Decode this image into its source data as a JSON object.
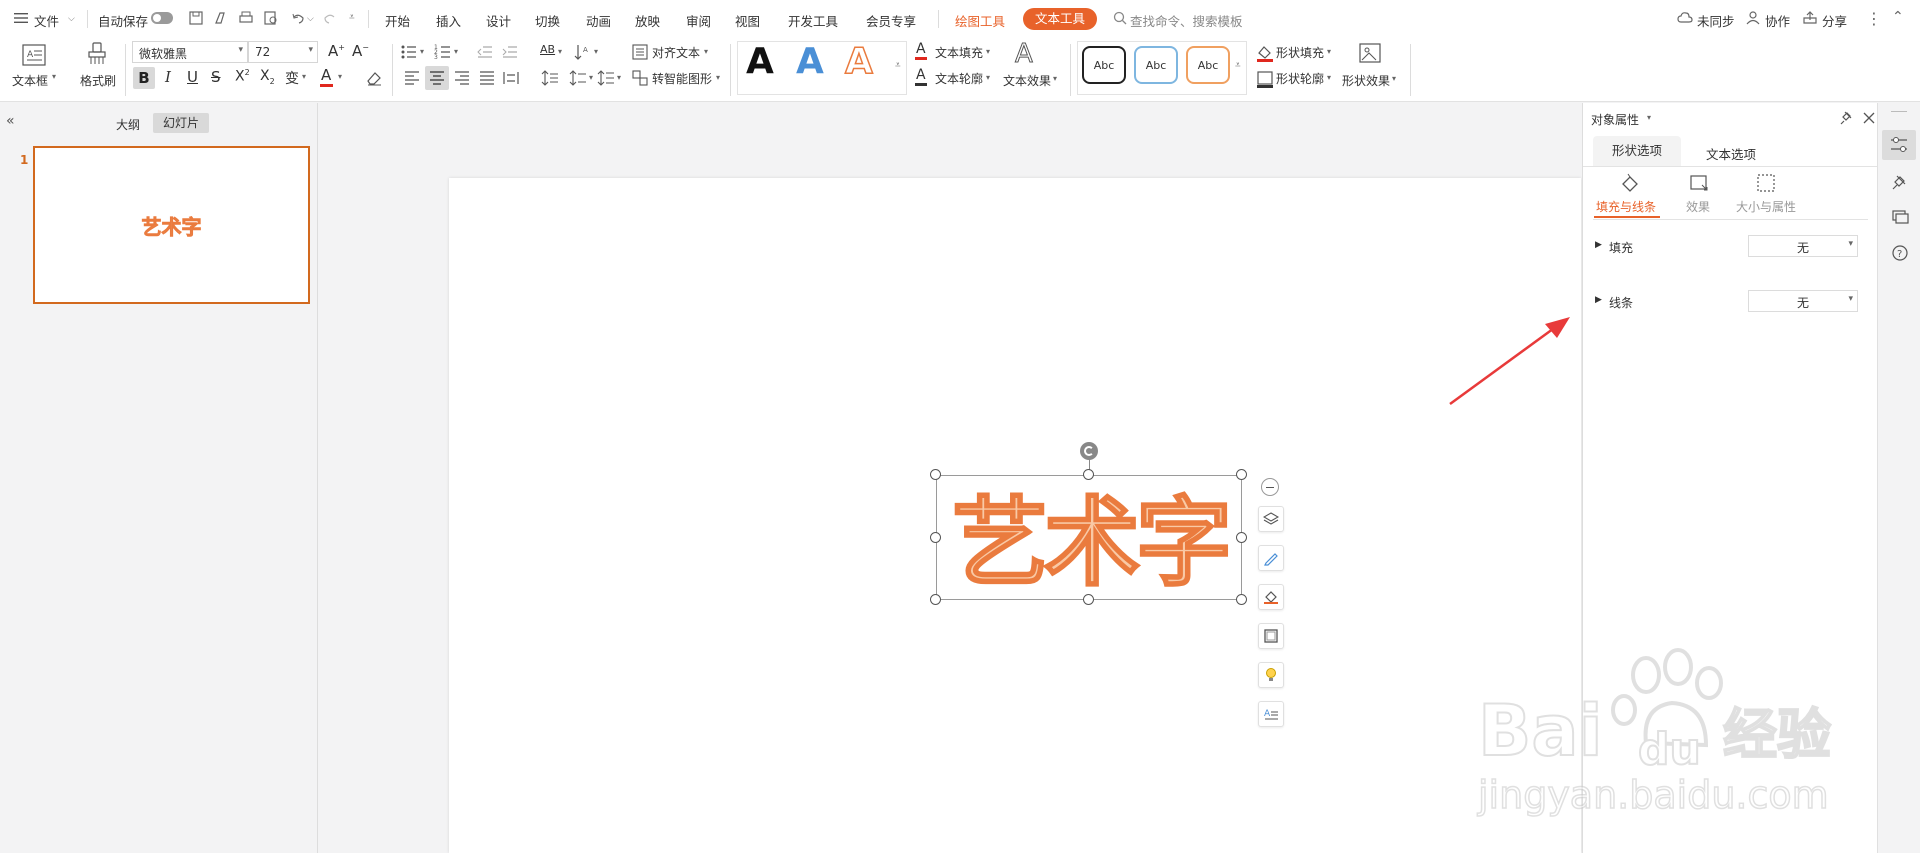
{
  "menubar": {
    "file": "文件",
    "autosave": "自动保存",
    "tabs": [
      "开始",
      "插入",
      "设计",
      "切换",
      "动画",
      "放映",
      "审阅",
      "视图",
      "开发工具",
      "会员专享"
    ],
    "drawing_tools": "绘图工具",
    "text_tools": "文本工具",
    "search_placeholder": "查找命令、搜索模板",
    "unsynced": "未同步",
    "collaborate": "协作",
    "share": "分享"
  },
  "ribbon": {
    "textbox": "文本框",
    "format_painter": "格式刷",
    "font_name": "微软雅黑",
    "font_size": "72",
    "align_text": "对齐文本",
    "smart_shape": "转智能图形",
    "wordart_letter": "A",
    "text_fill": "文本填充",
    "text_outline": "文本轮廓",
    "text_effect": "文本效果",
    "abc": "Abc",
    "shape_fill": "形状填充",
    "shape_outline": "形状轮廓",
    "shape_effect": "形状效果"
  },
  "leftpanel": {
    "tab_outline": "大纲",
    "tab_slides": "幻灯片",
    "slide_number": "1",
    "thumb_text": "艺术字"
  },
  "slide": {
    "wordart_text": "艺术字"
  },
  "proppanel": {
    "title": "对象属性",
    "tab_shape": "形状选项",
    "tab_text": "文本选项",
    "sub_fill_line": "填充与线条",
    "sub_effect": "效果",
    "sub_size": "大小与属性",
    "fill_label": "填充",
    "fill_value": "无",
    "line_label": "线条",
    "line_value": "无"
  },
  "watermark": {
    "brand": "Bai",
    "brand2": "du",
    "cn": "经验",
    "url": "jingyan.baidu.com"
  },
  "colors": {
    "accent": "#e8622a",
    "wordart_fill": "#f9c9a5",
    "wordart_stroke": "#ea7b3e",
    "arrow": "#e83a3a",
    "blue": "#4a8fd6"
  }
}
